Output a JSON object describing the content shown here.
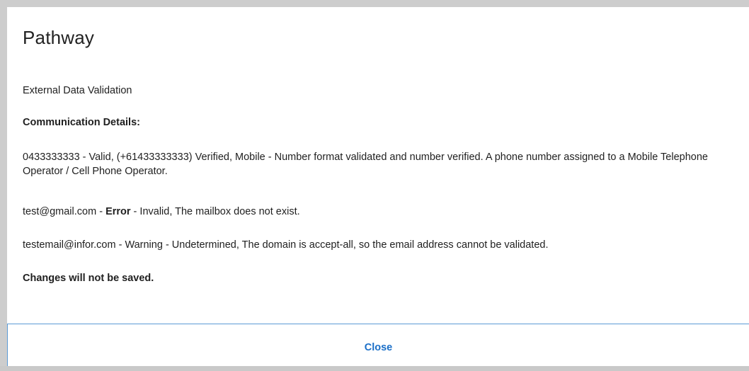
{
  "dialog": {
    "title": "Pathway",
    "subtitle": "External Data Validation",
    "section_heading": "Communication Details:",
    "phone_result": "0433333333 - Valid, (+61433333333) Verified, Mobile - Number format validated and number verified. A phone number assigned to a Mobile Telephone Operator / Cell Phone Operator.",
    "email_error": {
      "address": "test@gmail.com",
      "separator": " - ",
      "status": "Error",
      "message": " - Invalid, The mailbox does not exist."
    },
    "email_warning": "testemail@infor.com - Warning - Undetermined, The domain is accept-all, so the email address cannot be validated.",
    "changes_notice": "Changes will not be saved.",
    "close_label": "Close"
  },
  "colors": {
    "accent": "#1a6fc8",
    "footer_border": "#5b9bd5",
    "backdrop": "#cdcdcd"
  }
}
